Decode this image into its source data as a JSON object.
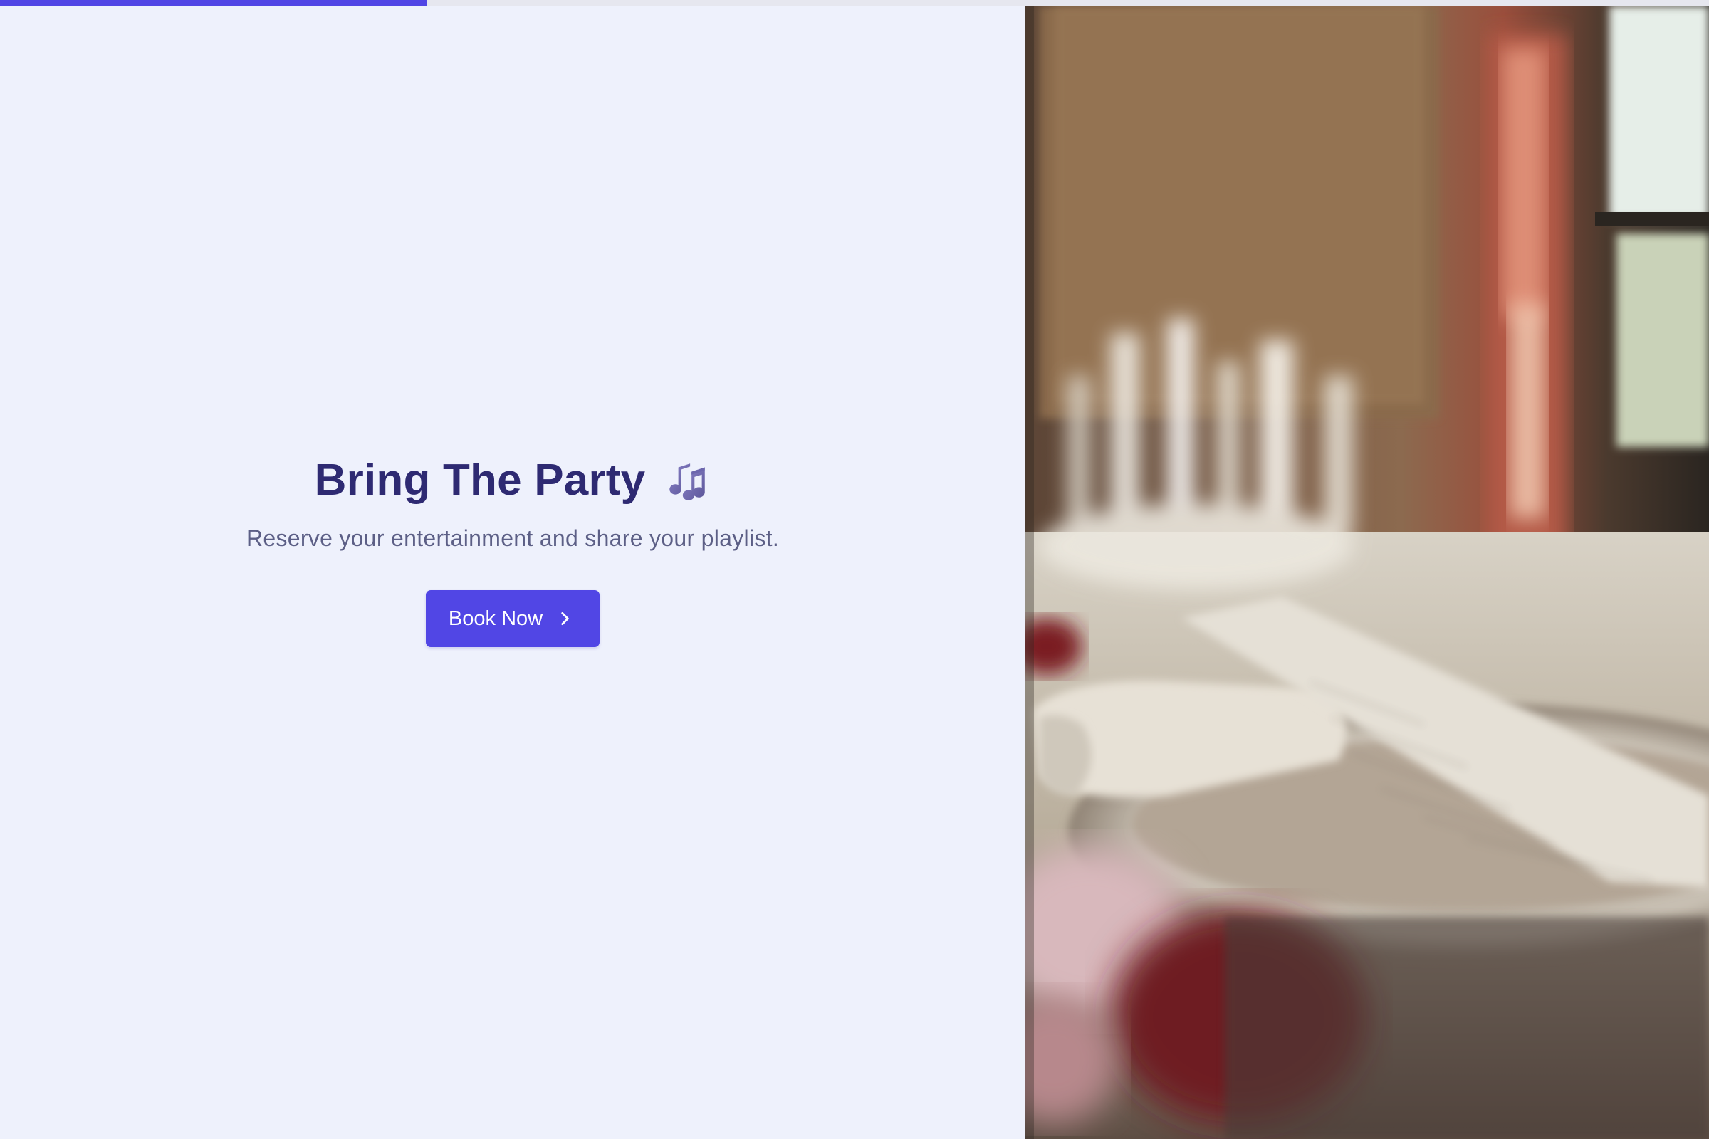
{
  "progress": {
    "value": 0.25,
    "color": "#5146e5"
  },
  "hero": {
    "title": "Bring The Party",
    "title_icon": "music-notes-icon",
    "subtitle": "Reserve your entertainment and share your playlist.",
    "cta_label": "Book Now",
    "cta_icon": "chevron-right-icon"
  },
  "colors": {
    "accent": "#5146e5",
    "title": "#2e2a72",
    "subtitle": "#5c5f86",
    "background": "#eef1fc"
  },
  "photo": {
    "subject": "dining-table-photo"
  }
}
